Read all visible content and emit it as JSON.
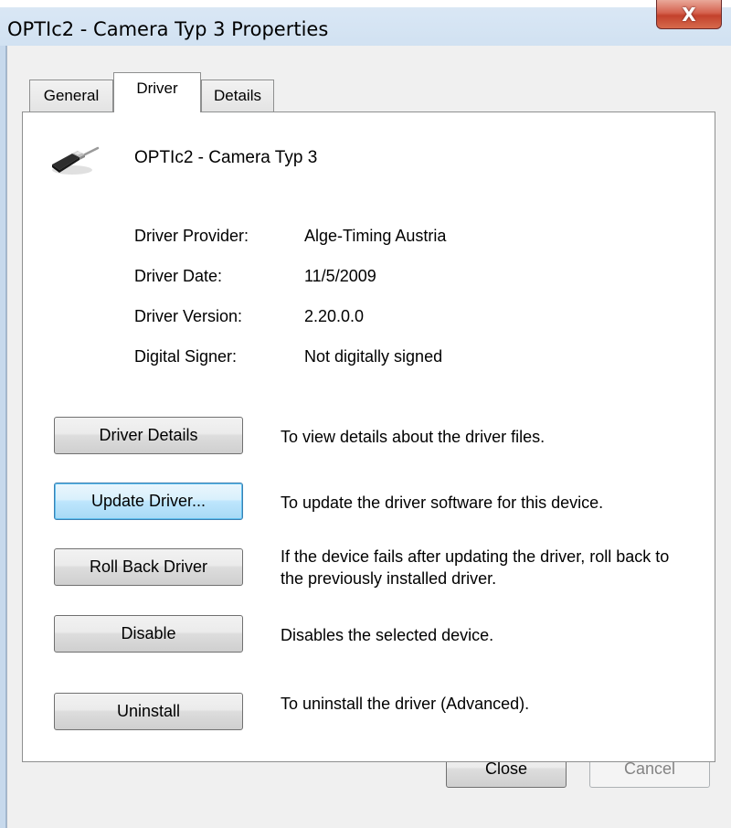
{
  "window": {
    "title": "OPTIc2 - Camera Typ 3 Properties",
    "close_glyph": "X"
  },
  "tabs": [
    {
      "label": "General",
      "active": false
    },
    {
      "label": "Driver",
      "active": true
    },
    {
      "label": "Details",
      "active": false
    }
  ],
  "device": {
    "icon": "usb-connector-icon",
    "name": "OPTIc2 - Camera Typ 3"
  },
  "properties": [
    {
      "label": "Driver Provider:",
      "value": "Alge-Timing Austria"
    },
    {
      "label": "Driver Date:",
      "value": "11/5/2009"
    },
    {
      "label": "Driver Version:",
      "value": "2.20.0.0"
    },
    {
      "label": "Digital Signer:",
      "value": "Not digitally signed"
    }
  ],
  "actions": [
    {
      "label": "Driver Details",
      "description": "To view details about the driver files."
    },
    {
      "label": "Update Driver...",
      "description": "To update the driver software for this device."
    },
    {
      "label": "Roll Back Driver",
      "description": "If the device fails after updating the driver, roll back to the previously installed driver."
    },
    {
      "label": "Disable",
      "description": "Disables the selected device."
    },
    {
      "label": "Uninstall",
      "description": "To uninstall the driver (Advanced)."
    }
  ],
  "footer": {
    "close_label": "Close",
    "cancel_label": "Cancel"
  },
  "colors": {
    "focus_button_border": "#3c7fb1",
    "close_button_red": "#c3412c",
    "disabled_text": "#838383"
  }
}
